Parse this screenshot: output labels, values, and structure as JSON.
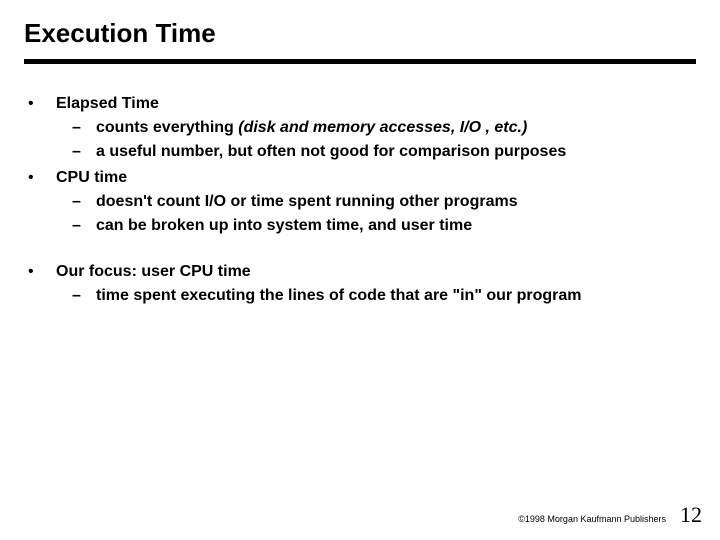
{
  "title": "Execution Time",
  "bullets": {
    "b1": {
      "head": "Elapsed Time",
      "sub1_pre": "counts everything  ",
      "sub1_ital": "(disk and memory accesses, I/O , etc.)",
      "sub2": "a useful number, but often not good for comparison purposes"
    },
    "b2": {
      "head": "CPU time",
      "sub1": "doesn't count I/O or time spent running other programs",
      "sub2": "can be broken up into system time, and user time"
    },
    "b3": {
      "head": "Our focus:  user CPU time",
      "sub1": "time spent executing the lines of code that are \"in\" our program"
    }
  },
  "footer": {
    "copyright": "©1998 Morgan Kaufmann Publishers",
    "page": "12"
  }
}
